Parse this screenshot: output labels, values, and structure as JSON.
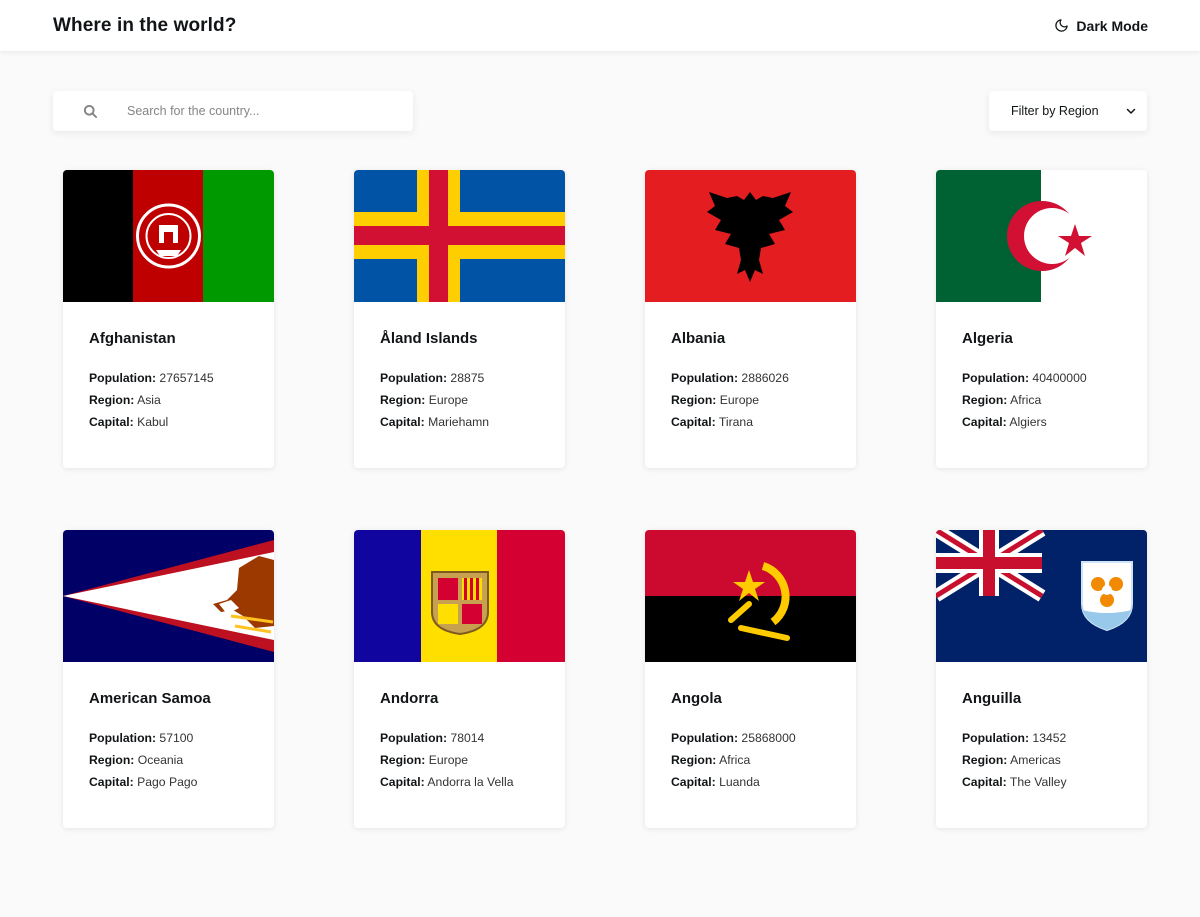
{
  "header": {
    "title": "Where in the world?",
    "dark_mode_label": "Dark Mode"
  },
  "search": {
    "placeholder": "Search for the country...",
    "value": ""
  },
  "filter": {
    "label": "Filter by Region"
  },
  "labels": {
    "population": "Population:",
    "region": "Region:",
    "capital": "Capital:"
  },
  "countries": [
    {
      "name": "Afghanistan",
      "population": "27657145",
      "region": "Asia",
      "capital": "Kabul"
    },
    {
      "name": "Åland Islands",
      "population": "28875",
      "region": "Europe",
      "capital": "Mariehamn"
    },
    {
      "name": "Albania",
      "population": "2886026",
      "region": "Europe",
      "capital": "Tirana"
    },
    {
      "name": "Algeria",
      "population": "40400000",
      "region": "Africa",
      "capital": "Algiers"
    },
    {
      "name": "American Samoa",
      "population": "57100",
      "region": "Oceania",
      "capital": "Pago Pago"
    },
    {
      "name": "Andorra",
      "population": "78014",
      "region": "Europe",
      "capital": "Andorra la Vella"
    },
    {
      "name": "Angola",
      "population": "25868000",
      "region": "Africa",
      "capital": "Luanda"
    },
    {
      "name": "Anguilla",
      "population": "13452",
      "region": "Americas",
      "capital": "The Valley"
    }
  ],
  "colors": {
    "background": "#fafafa",
    "card": "#ffffff",
    "text": "#111517"
  }
}
